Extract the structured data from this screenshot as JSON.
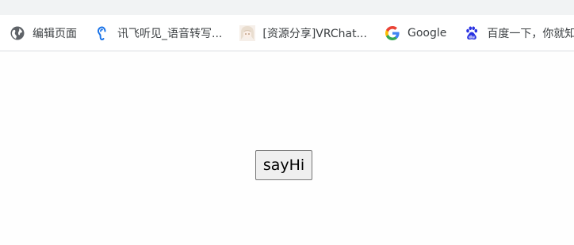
{
  "bookmarks": [
    {
      "icon": "globe-icon",
      "label": "编辑页面"
    },
    {
      "icon": "ear-icon",
      "label": "讯飞听见_语音转写..."
    },
    {
      "icon": "anime-avatar-icon",
      "label": "[资源分享]VRChat..."
    },
    {
      "icon": "google-icon",
      "label": "Google"
    },
    {
      "icon": "baidu-paw-icon",
      "label": "百度一下，你就知道"
    }
  ],
  "main": {
    "button_label": "sayHi"
  },
  "colors": {
    "google_blue": "#4285F4",
    "google_red": "#EA4335",
    "google_yellow": "#FBBC05",
    "google_green": "#34A853",
    "baidu_blue": "#2932E1",
    "ear_blue": "#1a73e8",
    "globe_gray": "#5f6368"
  }
}
